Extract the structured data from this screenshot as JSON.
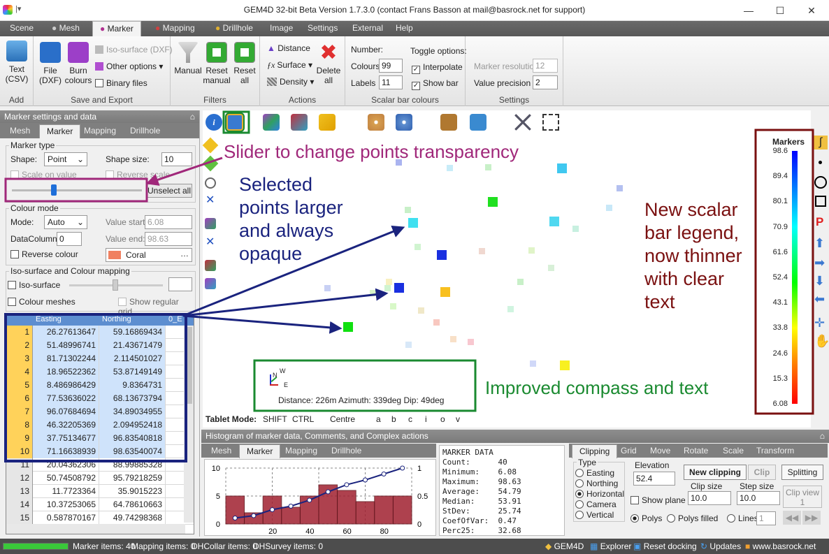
{
  "window": {
    "title": "GEM4D 32-bit Beta Version 1.7.3.0 (contact Frans Basson at mail@basrock.net for support)"
  },
  "ribbon_tabs": [
    "Scene",
    "Mesh",
    "Marker",
    "Mapping",
    "Drillhole",
    "Image",
    "Settings",
    "External",
    "Help"
  ],
  "ribbon": {
    "add": {
      "text_label": "Text\n(CSV)",
      "caption": "Add"
    },
    "save": {
      "file_label": "File\n(DXF)",
      "burn_label": "Burn\ncolours",
      "iso_label": "Iso-surface (DXF)",
      "other_label": "Other options",
      "binary_label": "Binary files",
      "caption": "Save and Export"
    },
    "filters": {
      "manual_label": "Manual",
      "reset_manual_label": "Reset\nmanual",
      "reset_all_label": "Reset\nall",
      "caption": "Filters"
    },
    "actions": {
      "distance_label": "Distance",
      "surface_label": "Surface",
      "density_label": "Density",
      "delete_label": "Delete\nall",
      "caption": "Actions"
    },
    "scalar": {
      "number_label": "Number:",
      "colours_label": "Colours",
      "colours_value": "99",
      "labels_label": "Labels",
      "labels_value": "11",
      "toggle_label": "Toggle options:",
      "interpolate_label": "Interpolate",
      "showbar_label": "Show bar",
      "caption": "Scalar bar colours"
    },
    "settings": {
      "resolution_label": "Marker resolution",
      "resolution_value": "12",
      "precision_label": "Value precision",
      "precision_value": "2",
      "caption": "Settings"
    }
  },
  "left_panel": {
    "header": "Marker settings and data",
    "tabs": [
      "Mesh",
      "Marker",
      "Mapping",
      "Drillhole"
    ],
    "marker_type": {
      "legend": "Marker type",
      "shape_label": "Shape:",
      "shape_value": "Point",
      "size_label": "Shape size:",
      "size_value": "10",
      "scale_label": "Scale on value",
      "reverse_scale_label": "Reverse scale",
      "unselect_label": "Unselect all",
      "transparency": 0.3
    },
    "colour_mode": {
      "legend": "Colour mode",
      "mode_label": "Mode:",
      "mode_value": "Auto",
      "vstart_label": "Value start:",
      "vstart_value": "6.08",
      "datacol_label": "DataColumn:",
      "datacol_value": "0",
      "vend_label": "Value end:",
      "vend_value": "98.63",
      "reverse_label": "Reverse colour",
      "colour_name": "Coral",
      "colour_hex": "#f08060"
    },
    "iso": {
      "legend": "Iso-surface and Colour mapping",
      "iso_label": "Iso-surface",
      "colour_meshes_label": "Colour meshes",
      "show_grid_label": "Show regular grid"
    },
    "grid": {
      "headers": [
        "Easting",
        "Northing",
        "0_E"
      ],
      "rows": [
        [
          "1",
          "26.27613647",
          "59.16869434"
        ],
        [
          "2",
          "51.48996741",
          "21.43671479"
        ],
        [
          "3",
          "81.71302244",
          "2.114501027"
        ],
        [
          "4",
          "18.96522362",
          "53.87149149"
        ],
        [
          "5",
          "8.486986429",
          "9.8364731"
        ],
        [
          "6",
          "77.53636022",
          "68.13673794"
        ],
        [
          "7",
          "96.07684694",
          "34.89034955"
        ],
        [
          "8",
          "46.32205369",
          "2.094952418"
        ],
        [
          "9",
          "37.75134677",
          "96.83540818"
        ],
        [
          "10",
          "71.16638939",
          "98.63540074"
        ],
        [
          "11",
          "20.04362306",
          "88.99885328"
        ],
        [
          "12",
          "50.74508792",
          "95.79218259"
        ],
        [
          "13",
          "11.7723364",
          "35.9015223"
        ],
        [
          "14",
          "10.37253065",
          "64.78610663"
        ],
        [
          "15",
          "0.587870167",
          "49.74298368"
        ]
      ]
    }
  },
  "viewport": {
    "compass_text": "Distance: 226m  Azimuth: 339deg  Dip: 49deg",
    "compass_labels": {
      "n": "N",
      "w": "W",
      "e": "E"
    },
    "tablet": {
      "label": "Tablet Mode:",
      "keys": [
        "SHIFT",
        "CTRL",
        "Centre",
        "a",
        "b",
        "c",
        "i",
        "o",
        "v"
      ]
    },
    "legend": {
      "title": "Markers",
      "ticks": [
        "98.6",
        "89.4",
        "80.1",
        "70.9",
        "61.6",
        "52.4",
        "43.1",
        "33.8",
        "24.6",
        "15.3",
        "6.08"
      ]
    }
  },
  "annotations": {
    "slider": "Slider to change points transparency",
    "selected": [
      "Selected",
      "points larger",
      "and always",
      "opaque"
    ],
    "scalar": [
      "New scalar",
      "bar legend,",
      "now thinner",
      "with clear",
      "text"
    ],
    "compass": "Improved compass and text"
  },
  "bottom": {
    "header": "Histogram of marker data, Comments, and Complex actions",
    "tabs": [
      "Mesh",
      "Marker",
      "Mapping",
      "Drillhole"
    ],
    "histogram": {
      "left_ticks": [
        "10",
        "5",
        "0"
      ],
      "right_ticks": [
        "1",
        "0.5",
        "0"
      ],
      "x_ticks": [
        "20",
        "40",
        "60",
        "80"
      ]
    },
    "stats": [
      [
        "MARKER DATA",
        ""
      ],
      [
        "Count:",
        "40"
      ],
      [
        "Minimum:",
        "6.08"
      ],
      [
        "Maximum:",
        "98.63"
      ],
      [
        "Average:",
        "54.79"
      ],
      [
        "Median:",
        "53.91"
      ],
      [
        "StDev:",
        "25.74"
      ],
      [
        "CoefOfVar:",
        "0.47"
      ],
      [
        "Perc25:",
        "32.68"
      ]
    ],
    "clip_tabs": [
      "Clipping",
      "Grid",
      "Move",
      "Rotate",
      "Scale",
      "Transform"
    ],
    "clip": {
      "type_label": "Type",
      "types": [
        "Easting",
        "Northing",
        "Horizontal",
        "Camera",
        "Vertical"
      ],
      "selected_type": "Horizontal",
      "elevation_label": "Elevation",
      "elevation_value": "52.4",
      "new_clipping": "New clipping",
      "clip": "Clip",
      "splitting": "Splitting",
      "show_plane": "Show plane",
      "clip_size_label": "Clip size",
      "clip_size_value": "10.0",
      "step_size_label": "Step size",
      "step_size_value": "10.0",
      "clip_view_label": "Clip view",
      "clip_view_value": "1",
      "polys": "Polys",
      "polys_filled": "Polys filled",
      "lines": "Lines",
      "lines_value": "1"
    }
  },
  "status": {
    "marker_items": "Marker items: 40",
    "mapping_items": "Mapping items: 0",
    "dhcollar": "DHCollar items: 0",
    "dhsurvey": "DHSurvey items: 0",
    "gem4d": "GEM4D",
    "explorer": "Explorer",
    "reset_docking": "Reset docking",
    "updates": "Updates",
    "website": "www.basrock.net"
  }
}
